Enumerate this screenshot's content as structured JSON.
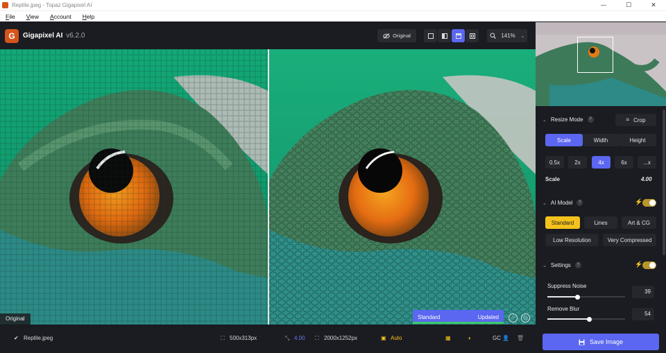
{
  "window": {
    "title": "Reptile.jpeg - Topaz Gigapixel AI",
    "minimize": "—",
    "maximize": "☐",
    "close": "✕"
  },
  "menu": [
    "File",
    "View",
    "Account",
    "Help"
  ],
  "header": {
    "logo_letter": "G",
    "app_name": "Gigapixel AI",
    "version": "v6.2.0",
    "original_label": "Original",
    "zoom": "141%"
  },
  "preview": {
    "left_label": "Original",
    "model_label": "Standard",
    "status_label": "Updated"
  },
  "bottom": {
    "filename": "Reptile.jpeg",
    "input_size": "500x313px",
    "scale_value": "4.00",
    "output_size": "2000x1252px",
    "auto_label": "Auto",
    "gc_label": "GC"
  },
  "sidebar": {
    "resize_mode": {
      "title": "Resize Mode",
      "crop_label": "Crop",
      "tabs": [
        "Scale",
        "Width",
        "Height"
      ],
      "scales": [
        "0.5x",
        "2x",
        "4x",
        "6x",
        "...x"
      ],
      "scale_label": "Scale",
      "scale_value": "4.00"
    },
    "ai_model": {
      "title": "AI Model",
      "models_row1": [
        "Standard",
        "Lines",
        "Art & CG"
      ],
      "models_row2": [
        "Low Resolution",
        "Very Compressed"
      ]
    },
    "settings": {
      "title": "Settings",
      "suppress_noise_label": "Suppress Noise",
      "suppress_noise_value": "39",
      "suppress_noise_level": 0.39,
      "remove_blur_label": "Remove Blur",
      "remove_blur_value": "54",
      "remove_blur_level": 0.54
    },
    "save_label": "Save Image"
  },
  "colors": {
    "accent": "#5b67f0",
    "highlight": "#f4c21c",
    "logo": "#d4541c",
    "panel": "#1b1c21"
  }
}
